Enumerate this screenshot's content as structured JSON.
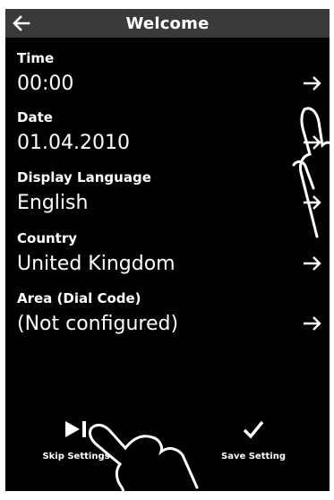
{
  "header": {
    "title": "Welcome",
    "back_icon": "arrow-left-icon"
  },
  "rows": [
    {
      "label": "Time",
      "value": "00:00"
    },
    {
      "label": "Date",
      "value": "01.04.2010"
    },
    {
      "label": "Display Language",
      "value": "English"
    },
    {
      "label": "Country",
      "value": "United Kingdom"
    },
    {
      "label": "Area (Dial Code)",
      "value": "(Not configured)"
    }
  ],
  "footer": {
    "skip": {
      "label": "Skip Settings",
      "icon": "play-skip-icon"
    },
    "save": {
      "label": "Save Setting",
      "icon": "checkmark-icon"
    }
  },
  "colors": {
    "background": "#000000",
    "title_bar": "#3a3a3a",
    "text": "#ffffff"
  }
}
